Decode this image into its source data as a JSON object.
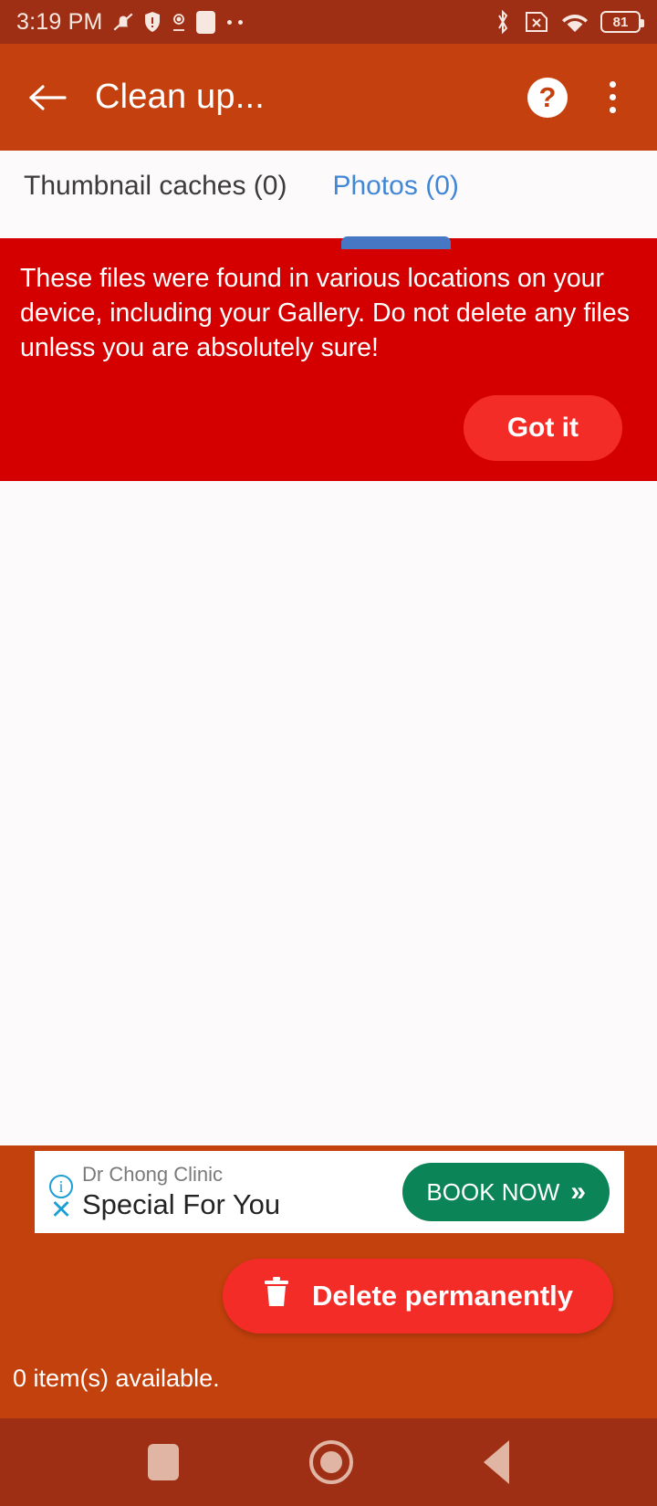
{
  "status_bar": {
    "clock": "3:19 PM",
    "battery_percent": "81",
    "left_icons": [
      "mute-bell-icon",
      "shield-icon",
      "location-pin-icon",
      "screenshot-square-icon",
      "more-dots-icon"
    ],
    "right_icons": [
      "bluetooth-icon",
      "no-sim-icon",
      "wifi-icon",
      "battery-icon"
    ]
  },
  "app_bar": {
    "title": "Clean up...",
    "back_icon": "back-arrow-icon",
    "help_icon": "help-question-icon",
    "help_glyph": "?",
    "overflow_icon": "overflow-menu-icon",
    "background": "#c4410f"
  },
  "tabs": [
    {
      "label": "Thumbnail caches (0)",
      "active": false
    },
    {
      "label": "Photos (0)",
      "active": true
    }
  ],
  "tab_accent": "#4577c4",
  "banner": {
    "message": "These files were found in various locations on your device, including your Gallery. Do not delete any files unless you are absolutely sure!",
    "button_label": "Got it",
    "background": "#d40000",
    "button_color": "#f42c28"
  },
  "ad": {
    "advertiser": "Dr Chong Clinic",
    "headline": "Special For You",
    "cta_label": "BOOK NOW",
    "cta_chevron": "»",
    "info_glyph": "i",
    "close_glyph": "✕",
    "cta_color": "#0b8457"
  },
  "bottom": {
    "delete_label": "Delete permanently",
    "delete_icon": "trash-icon",
    "delete_color": "#f42c28",
    "status_text": "0 item(s) available."
  },
  "nav_bar": {
    "recents_icon": "recents-square-icon",
    "home_icon": "home-circle-icon",
    "back_icon": "back-triangle-icon"
  }
}
